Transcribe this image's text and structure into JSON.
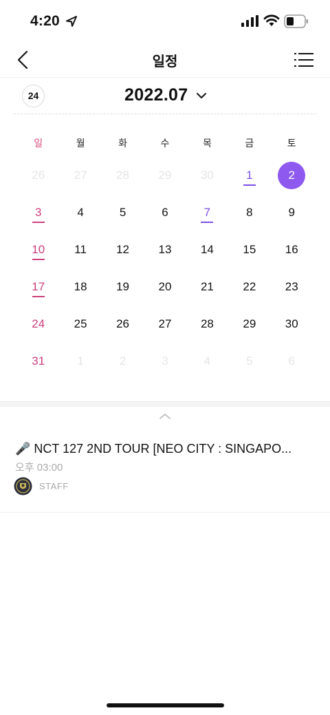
{
  "status_bar": {
    "time": "4:20"
  },
  "nav": {
    "title": "일정"
  },
  "month_bar": {
    "today_badge": "24",
    "month_label": "2022.07"
  },
  "calendar": {
    "weekdays": [
      "일",
      "월",
      "화",
      "수",
      "목",
      "금",
      "토"
    ],
    "weeks": [
      [
        "26",
        "27",
        "28",
        "29",
        "30",
        "1",
        "2"
      ],
      [
        "3",
        "4",
        "5",
        "6",
        "7",
        "8",
        "9"
      ],
      [
        "10",
        "11",
        "12",
        "13",
        "14",
        "15",
        "16"
      ],
      [
        "17",
        "18",
        "19",
        "20",
        "21",
        "22",
        "23"
      ],
      [
        "24",
        "25",
        "26",
        "27",
        "28",
        "29",
        "30"
      ],
      [
        "31",
        "1",
        "2",
        "3",
        "4",
        "5",
        "6"
      ]
    ],
    "selected_day": "2",
    "accent_color": "#8e59ef",
    "sunday_color": "#cc3f7d"
  },
  "event": {
    "title": "🎤 NCT 127 2ND TOUR [NEO CITY : SINGAPO...",
    "time": "오후 03:00",
    "writer": "STAFF"
  }
}
